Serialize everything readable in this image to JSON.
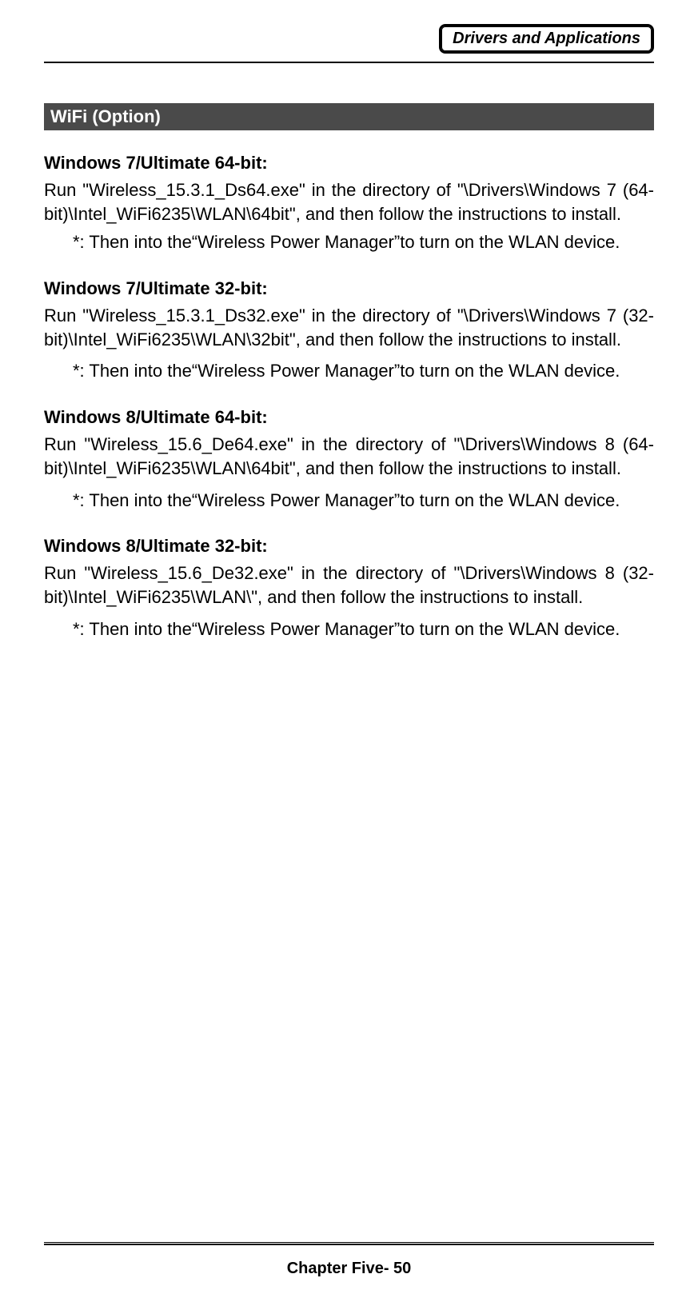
{
  "header": {
    "chapter_title": "Drivers and Applications"
  },
  "section": {
    "title": " WiFi (Option)"
  },
  "blocks": [
    {
      "heading": "Windows 7/Ultimate 64-bit:",
      "para": "Run \"Wireless_15.3.1_Ds64.exe\" in the directory of \"\\Drivers\\Windows 7 (64-bit)\\Intel_WiFi6235\\WLAN\\64bit\", and then follow the instructions to install.",
      "note": "*: Then into the“Wireless Power Manager”to turn on the WLAN device."
    },
    {
      "heading": "Windows 7/Ultimate 32-bit:",
      "para": "Run \"Wireless_15.3.1_Ds32.exe\" in the directory of \"\\Drivers\\Windows 7 (32-bit)\\Intel_WiFi6235\\WLAN\\32bit\", and then follow the instructions to install.",
      "note": "*: Then into the“Wireless Power Manager”to turn on the WLAN device."
    },
    {
      "heading": "Windows 8/Ultimate 64-bit:",
      "para": "Run \"Wireless_15.6_De64.exe\" in the directory of \"\\Drivers\\Windows 8 (64-bit)\\Intel_WiFi6235\\WLAN\\64bit\", and then follow the instructions to install.",
      "note": "*: Then into the“Wireless Power Manager”to turn on the WLAN device."
    },
    {
      "heading": "Windows 8/Ultimate 32-bit:",
      "para": "Run \"Wireless_15.6_De32.exe\" in the directory of \"\\Drivers\\Windows 8 (32-bit)\\Intel_WiFi6235\\WLAN\\\", and then follow the instructions to install.",
      "note": "*: Then into the“Wireless Power Manager”to turn on the WLAN device."
    }
  ],
  "footer": {
    "text": "Chapter Five- 50"
  }
}
